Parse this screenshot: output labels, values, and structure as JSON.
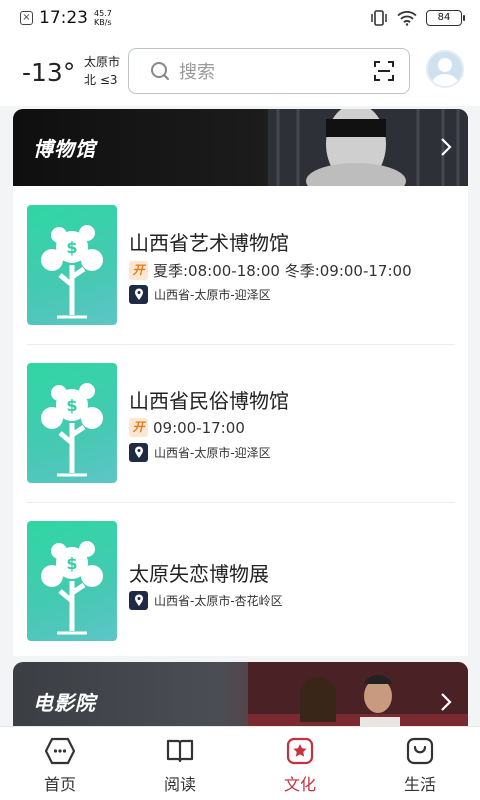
{
  "status_bar": {
    "time": "17:23",
    "net_speed_value": "45.7",
    "net_speed_unit": "KB/s",
    "battery": "84"
  },
  "header": {
    "temperature": "-13°",
    "city": "太原市",
    "wind": "北  ≤3",
    "search_placeholder": "搜索"
  },
  "museum_section": {
    "title": "博物馆",
    "items": [
      {
        "name": "山西省艺术博物馆",
        "hours": "夏季:08:00-18:00 冬季:09:00-17:00",
        "location": "山西省-太原市-迎泽区"
      },
      {
        "name": "山西省民俗博物馆",
        "hours": "09:00-17:00",
        "location": "山西省-太原市-迎泽区"
      },
      {
        "name": "太原失恋博物展",
        "hours": "",
        "location": "山西省-太原市-杏花岭区"
      }
    ],
    "open_tag": "开"
  },
  "cinema_section": {
    "title": "电影院"
  },
  "bottom_nav": {
    "items": [
      {
        "label": "首页",
        "icon": "home-icon"
      },
      {
        "label": "阅读",
        "icon": "book-icon"
      },
      {
        "label": "文化",
        "icon": "star-badge-icon"
      },
      {
        "label": "生活",
        "icon": "bag-icon"
      }
    ],
    "active": "文化",
    "active_color": "#c6313e"
  },
  "colors": {
    "thumb_green": "#2fd6a3",
    "open_tag_bg": "#fde7d3",
    "open_tag_fg": "#e47a1e",
    "location_tag_bg": "#1f2a44"
  }
}
